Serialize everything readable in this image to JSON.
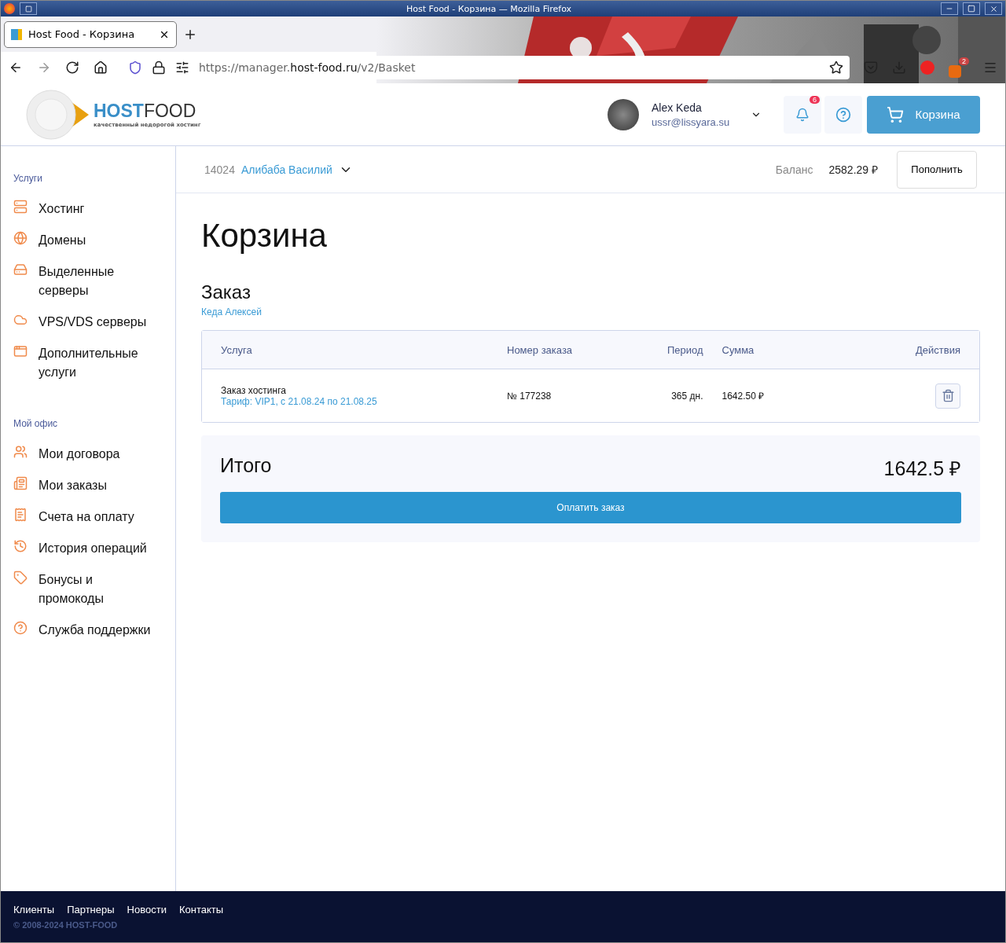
{
  "window": {
    "title": "Host Food - Корзина — Mozilla Firefox"
  },
  "browser": {
    "tabs": [
      {
        "label": "Host Food - Корзина",
        "selected": true
      }
    ],
    "url": {
      "prefix": "https://manager.",
      "domain": "host-food.ru",
      "path": "/v2/Basket"
    },
    "extension_badge": "2"
  },
  "header": {
    "logo": {
      "first": "HOST",
      "second": "FOOD",
      "tagline": "качественный недорогой хостинг"
    },
    "user": {
      "name": "Alex Keda",
      "email": "ussr@lissyara.su"
    },
    "notifications_badge": "6",
    "cart_button": "Корзина"
  },
  "account_bar": {
    "id": "14024",
    "name": "Алибаба Василий",
    "balance_label": "Баланс",
    "balance": "2582.29 ₽",
    "topup_button": "Пополнить"
  },
  "sidebar": {
    "sections": [
      {
        "title": "Услуги",
        "items": [
          {
            "label": "Хостинг"
          },
          {
            "label": "Домены"
          },
          {
            "label": "Выделенные серверы"
          },
          {
            "label": "VPS/VDS серверы"
          },
          {
            "label": "Дополнительные услуги"
          }
        ]
      },
      {
        "title": "Мой офис",
        "items": [
          {
            "label": "Мои договора"
          },
          {
            "label": "Мои заказы"
          },
          {
            "label": "Счета на оплату"
          },
          {
            "label": "История операций"
          },
          {
            "label": "Бонусы и промокоды"
          },
          {
            "label": "Служба поддержки"
          }
        ]
      }
    ]
  },
  "page": {
    "title": "Корзина",
    "order_title": "Заказ",
    "order_owner": "Кеда Алексей",
    "table": {
      "columns": [
        "Услуга",
        "Номер заказа",
        "Период",
        "Сумма",
        "Действия"
      ],
      "rows": [
        {
          "service": "Заказ хостинга",
          "tariff": "Тариф: VIP1, с 21.08.24 по 21.08.25",
          "number": "№ 177238",
          "period": "365 дн.",
          "sum": "1642.50 ₽"
        }
      ]
    },
    "total_label": "Итого",
    "total": "1642.5 ₽",
    "pay_button": "Оплатить заказ"
  },
  "footer": {
    "links": [
      "Клиенты",
      "Партнеры",
      "Новости",
      "Контакты"
    ],
    "copyright": "© 2008-2024 HOST-FOOD"
  }
}
